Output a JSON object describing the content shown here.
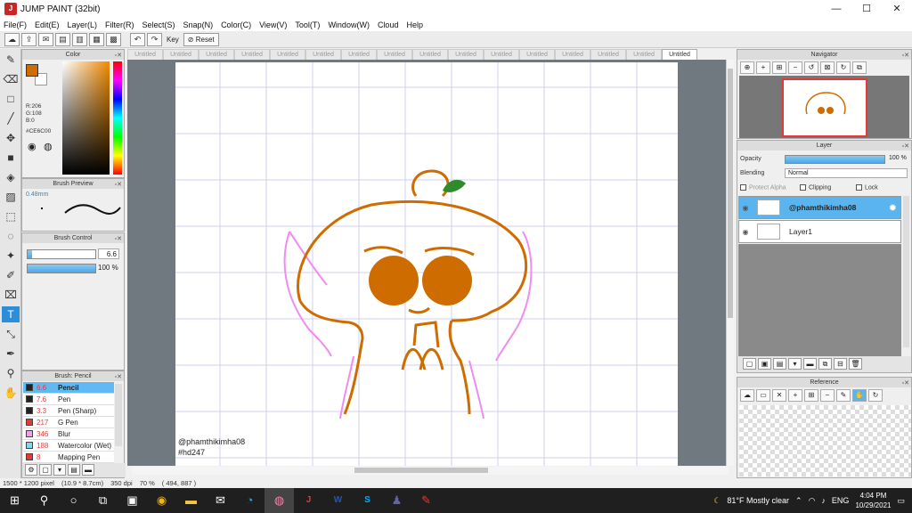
{
  "window": {
    "title": "JUMP PAINT (32bit)"
  },
  "menu": [
    "File(F)",
    "Edit(E)",
    "Layer(L)",
    "Filter(R)",
    "Select(S)",
    "Snap(N)",
    "Color(C)",
    "View(V)",
    "Tool(T)",
    "Window(W)",
    "Cloud",
    "Help"
  ],
  "toolbar": {
    "key_label": "Key",
    "reset_label": "Reset"
  },
  "tabs": [
    "Untitled",
    "Untitled",
    "Untitled",
    "Untitled",
    "Untitled",
    "Untitled",
    "Untitled",
    "Untitled",
    "Untitled",
    "Untitled",
    "Untitled",
    "Untitled",
    "Untitled",
    "Untitled",
    "Untitled",
    "Untitled"
  ],
  "color_panel": {
    "title": "Color",
    "r": "R:206",
    "g": "G:108",
    "b": "B:0",
    "hex": "#CE6C00",
    "current_color": "#CE6C00"
  },
  "brush_preview": {
    "title": "Brush Preview",
    "size": "0.48mm"
  },
  "brush_control": {
    "title": "Brush Control",
    "size_value": "6.6",
    "opacity_value": "100 %",
    "size_fraction": 0.06,
    "opacity_fraction": 1.0
  },
  "brush_list": {
    "title": "Brush: Pencil",
    "items": [
      {
        "size": "6.6",
        "name": "Pencil",
        "color": "#222222"
      },
      {
        "size": "7.6",
        "name": "Pen",
        "color": "#222222"
      },
      {
        "size": "3.3",
        "name": "Pen (Sharp)",
        "color": "#222222"
      },
      {
        "size": "217",
        "name": "G Pen",
        "color": "#e53935"
      },
      {
        "size": "346",
        "name": "Blur",
        "color": "#f0a0e8"
      },
      {
        "size": "188",
        "name": "Watercolor (Wet)",
        "color": "#80d8f0"
      },
      {
        "size": "8",
        "name": "Mapping Pen",
        "color": "#e53935"
      }
    ]
  },
  "canvas": {
    "watermark_line1": "@phamthikimha08",
    "watermark_line2": "#hd247"
  },
  "navigator": {
    "title": "Navigator"
  },
  "layer_panel": {
    "title": "Layer",
    "opacity_label": "Opacity",
    "opacity_value": "100 %",
    "blending_label": "Blending",
    "blending_value": "Normal",
    "protect_alpha": "Protect Alpha",
    "clipping": "Clipping",
    "lock": "Lock",
    "layers": [
      {
        "name": "@phamthikimha08"
      },
      {
        "name": "Layer1"
      }
    ]
  },
  "reference": {
    "title": "Reference"
  },
  "status": {
    "pixel": "1500 * 1200 pixel",
    "cm": "(10.9 * 8.7cm)",
    "dpi": "350 dpi",
    "zoom": "70 %",
    "coords": "( 494, 887 )"
  },
  "taskbar": {
    "weather": "81°F  Mostly clear",
    "lang": "ENG",
    "time": "4:04 PM",
    "date": "10/29/2021"
  }
}
